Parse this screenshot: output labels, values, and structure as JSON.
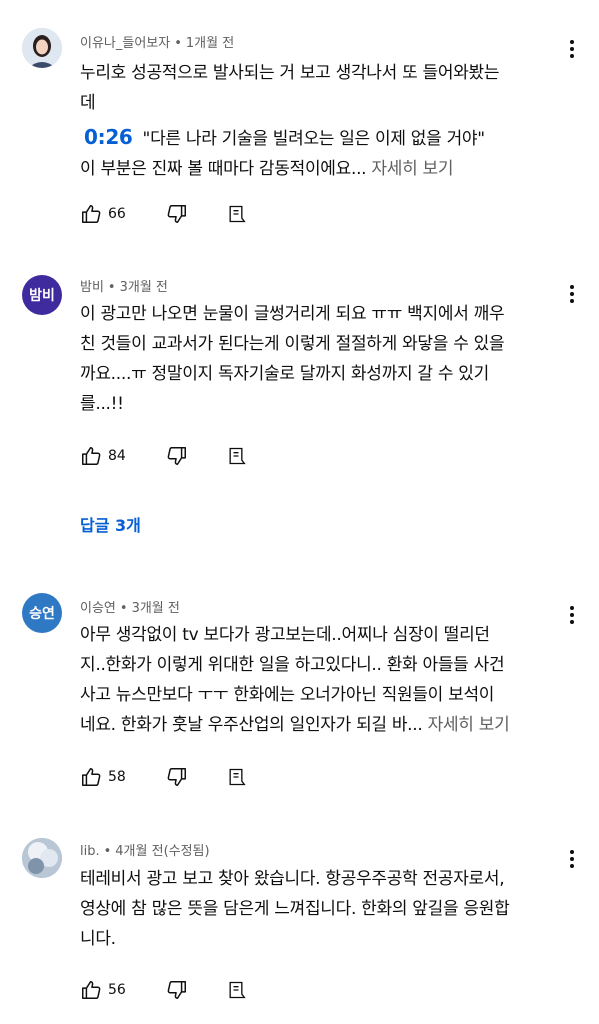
{
  "comments": [
    {
      "author": "이유나_들어보자",
      "time": "1개월 전",
      "avatar_text": "",
      "avatar_color": "#c9d6e6",
      "lines": [
        "누리호 성공적으로 발사되는 거 보고 생각나서 또 들어와봤는",
        "데"
      ],
      "timestamp": "0:26",
      "quote": "\"다른 나라 기술을 빌려오는 일은 이제 없을 거야\"",
      "last_line": "이 부분은 진짜 볼 때마다 감동적이에요...",
      "more": "자세히 보기",
      "likes": "66"
    },
    {
      "author": "밤비",
      "time": "3개월 전",
      "avatar_text": "밤비",
      "avatar_color": "#3f2a9e",
      "lines": [
        "이 광고만 나오면 눈물이 글썽거리게 되요 ㅠㅠ 백지에서 깨우",
        "친 것들이 교과서가 된다는게 이렇게 절절하게 와닿을 수 있을",
        "까요....ㅠ 정말이지 독자기술로 달까지 화성까지 갈 수 있기",
        "를...!!"
      ],
      "likes": "84",
      "replies": "답글 3개"
    },
    {
      "author": "이승연",
      "time": "3개월 전",
      "avatar_text": "승연",
      "avatar_color": "#2f78c4",
      "lines": [
        "아무 생각없이 tv 보다가 광고보는데..어찌나 심장이 떨리던",
        "지..한화가 이렇게 위대한 일을 하고있다니.. 환화 아들들 사건",
        "사고 뉴스만보다  ㅜㅜ 한화에는 오너가아닌 직원들이 보석이"
      ],
      "last_line": "네요. 한화가 훗날 우주산업의 일인자가 되길 바...",
      "more": "자세히 보기",
      "likes": "58"
    },
    {
      "author": "lib.",
      "time": "4개월 전(수정됨)",
      "avatar_text": "",
      "avatar_color": "#9fb0c4",
      "lines": [
        "테레비서 광고 보고 찾아 왔습니다. 항공우주공학 전공자로서,",
        "영상에 참 많은 뜻을 담은게 느껴집니다. 한화의 앞길을 응원합",
        "니다."
      ],
      "likes": "56"
    }
  ],
  "icons": {
    "like": "thumbs-up-icon",
    "dislike": "thumbs-down-icon",
    "reply": "reply-icon",
    "menu": "more-vert-icon"
  },
  "colors": {
    "link": "#065fd4",
    "meta": "#606060",
    "text": "#0f0f0f"
  }
}
